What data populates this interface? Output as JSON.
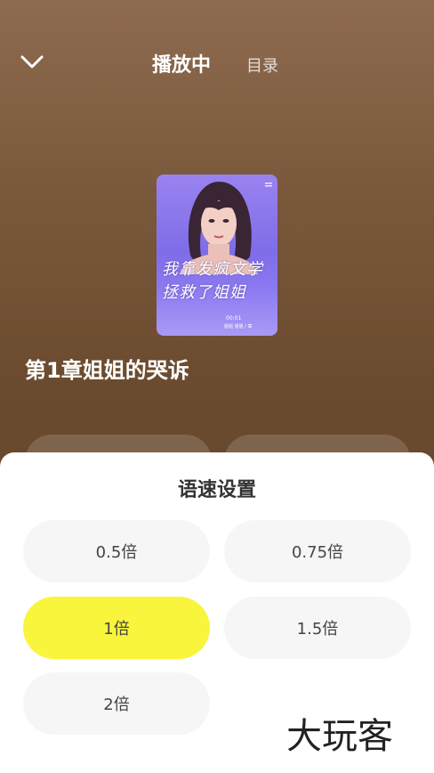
{
  "header": {
    "title": "播放中",
    "catalog_label": "目录"
  },
  "book": {
    "cover_line1": "我靠发疯文学",
    "cover_line2": "拯救了姐姐",
    "cover_episode": "00:01",
    "cover_subtitle": "姐姐 姐姐 / 章",
    "chapter_title": "第1章姐姐的哭诉"
  },
  "speed_sheet": {
    "title": "语速设置",
    "options": [
      "0.5倍",
      "0.75倍",
      "1倍",
      "1.5倍",
      "2倍"
    ],
    "selected": "1倍",
    "active_color": "#f8f53c"
  },
  "watermark": {
    "text": "大玩客"
  }
}
